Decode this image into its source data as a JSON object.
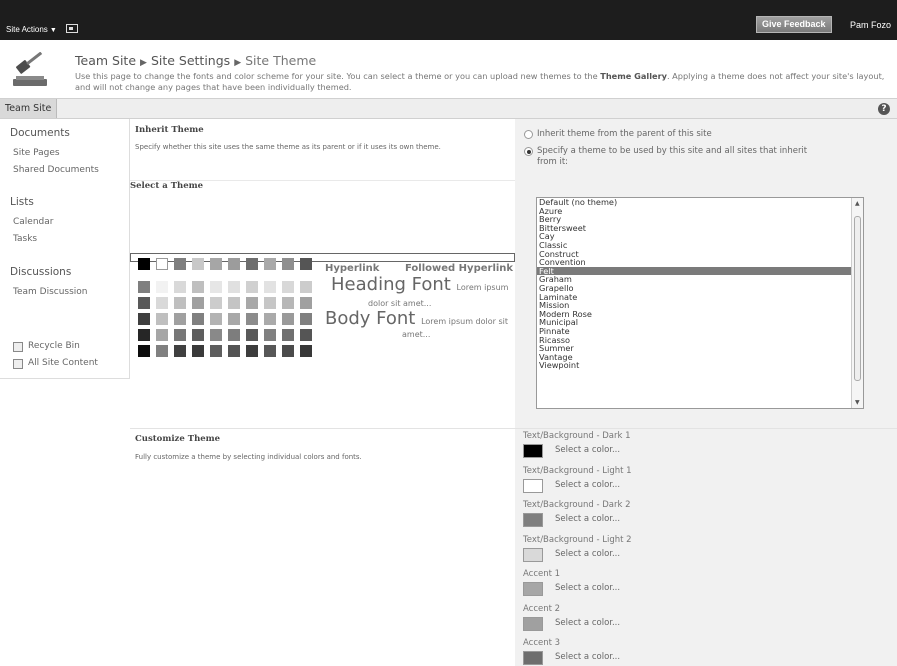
{
  "topbar": {
    "site_actions": "Site Actions",
    "feedback": "Give Feedback",
    "user": "Pam Fozo"
  },
  "header": {
    "crumbs": [
      "Team Site",
      "Site Settings",
      "Site Theme"
    ],
    "description_a": "Use this page to change the fonts and color scheme for your site. You can select a theme or you can upload new themes to the",
    "description_link": "Theme Gallery",
    "description_b": ". Applying a theme does not affect your site's layout, and will not change any pages that have been individually themed."
  },
  "navbar": {
    "tab": "Team Site",
    "help": "?"
  },
  "quicklaunch": {
    "documents": "Documents",
    "site_pages": "Site Pages",
    "shared_documents": "Shared Documents",
    "lists": "Lists",
    "calendar": "Calendar",
    "tasks": "Tasks",
    "discussions": "Discussions",
    "team_discussion": "Team Discussion",
    "recycle_bin": "Recycle Bin",
    "all_site_content": "All Site Content"
  },
  "inherit": {
    "title": "Inherit Theme",
    "desc": "Specify whether this site uses the same theme as its parent or if it uses its own theme.",
    "option1": "Inherit theme from the parent of this site",
    "option2": "Specify a theme to be used by this site and all sites that inherit from it:",
    "selected": 2
  },
  "select_theme": {
    "title": "Select a Theme",
    "themes": [
      "Default (no theme)",
      "Azure",
      "Berry",
      "Bittersweet",
      "Cay",
      "Classic",
      "Construct",
      "Convention",
      "Felt",
      "Graham",
      "Grapello",
      "Laminate",
      "Mission",
      "Modern Rose",
      "Municipal",
      "Pinnate",
      "Ricasso",
      "Summer",
      "Vantage",
      "Viewpoint"
    ],
    "selected_theme": "Felt"
  },
  "preview": {
    "hyperlink": "Hyperlink",
    "followed": "Followed Hyperlink",
    "heading": "Heading Font",
    "body": "Body Font",
    "lorem_h1": "Lorem ipsum",
    "lorem_h2": "dolor sit amet...",
    "lorem_b1": "Lorem ipsum dolor sit",
    "lorem_b2": "amet...",
    "top_row": [
      "#000000",
      "#ffffff",
      "#7f7f7f",
      "#c8c8c8",
      "#a6a6a6",
      "#9c9c9c",
      "#6e6e6e",
      "#a9a9a9",
      "#8f8f8f",
      "#555555"
    ],
    "grid_rows": [
      [
        "#7f7f7f",
        "#f2f2f2",
        "#d9d9d9",
        "#bfbfbf",
        "#e6e6e6",
        "#e0e0e0",
        "#d0d0d0",
        "#e2e2e2",
        "#d8d8d8",
        "#cccccc"
      ],
      [
        "#595959",
        "#d9d9d9",
        "#bfbfbf",
        "#a0a0a0",
        "#cccccc",
        "#c4c4c4",
        "#a8a8a8",
        "#c6c6c6",
        "#b7b7b7",
        "#a0a0a0"
      ],
      [
        "#3f3f3f",
        "#bfbfbf",
        "#a0a0a0",
        "#808080",
        "#b3b3b3",
        "#a8a8a8",
        "#8c8c8c",
        "#aaaaaa",
        "#9a9a9a",
        "#808080"
      ],
      [
        "#262626",
        "#a6a6a6",
        "#777777",
        "#5e5e5e",
        "#898989",
        "#7d7d7d",
        "#595959",
        "#808080",
        "#707070",
        "#555555"
      ],
      [
        "#0d0d0d",
        "#808080",
        "#404040",
        "#3a3a3a",
        "#5e5e5e",
        "#545454",
        "#3d3d3d",
        "#575757",
        "#4b4b4b",
        "#383838"
      ]
    ]
  },
  "customize": {
    "title": "Customize Theme",
    "desc": "Fully customize a theme by selecting individual colors and fonts.",
    "select_text": "Select a color...",
    "items": [
      {
        "label": "Text/Background - Dark 1",
        "color": "#000000"
      },
      {
        "label": "Text/Background - Light 1",
        "color": "#ffffff"
      },
      {
        "label": "Text/Background - Dark 2",
        "color": "#7f7f7f"
      },
      {
        "label": "Text/Background - Light 2",
        "color": "#d9d9d9"
      },
      {
        "label": "Accent 1",
        "color": "#a6a6a6"
      },
      {
        "label": "Accent 2",
        "color": "#a0a0a0"
      },
      {
        "label": "Accent 3",
        "color": "#6e6e6e"
      }
    ]
  }
}
